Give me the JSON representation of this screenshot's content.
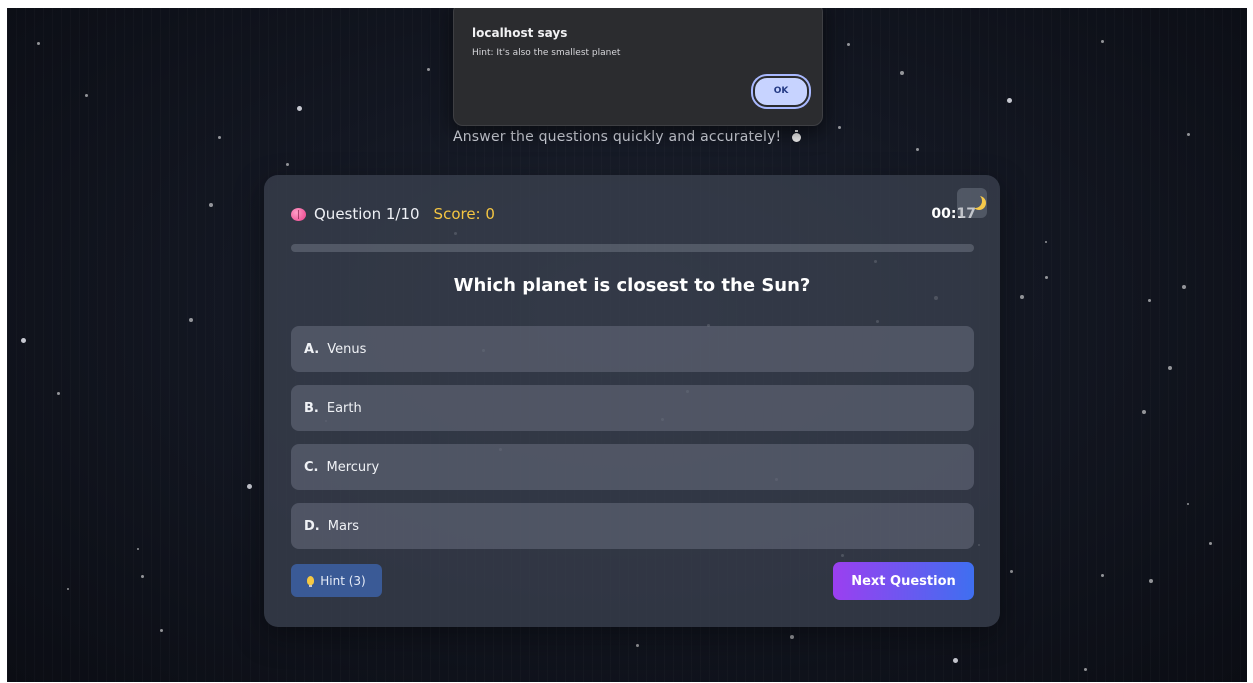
{
  "dialog": {
    "title": "localhost says",
    "message": "Hint: It's also the smallest planet",
    "ok_label": "OK"
  },
  "page": {
    "subtitle": "Answer the questions quickly and accurately!",
    "subtitle_icon": "stopwatch-icon"
  },
  "quiz": {
    "question_counter": "Question 1/10",
    "counter_icon": "brain-icon",
    "score": "Score: 0",
    "timer": "00:17",
    "theme_toggle_icon": "moon-icon",
    "progress": 0,
    "question": "Which planet is closest to the Sun?",
    "options": [
      {
        "letter": "A.",
        "text": "Venus"
      },
      {
        "letter": "B.",
        "text": "Earth"
      },
      {
        "letter": "C.",
        "text": "Mercury"
      },
      {
        "letter": "D.",
        "text": "Mars"
      }
    ],
    "hint_label": "Hint (3)",
    "hint_icon": "lightbulb-icon",
    "next_label": "Next Question"
  },
  "colors": {
    "score": "#f4c542",
    "hint_button": "#3a5a96",
    "next_gradient_start": "#9b3ff0",
    "next_gradient_end": "#3f6ff0",
    "dialog_ok": "#c7d3ff"
  }
}
